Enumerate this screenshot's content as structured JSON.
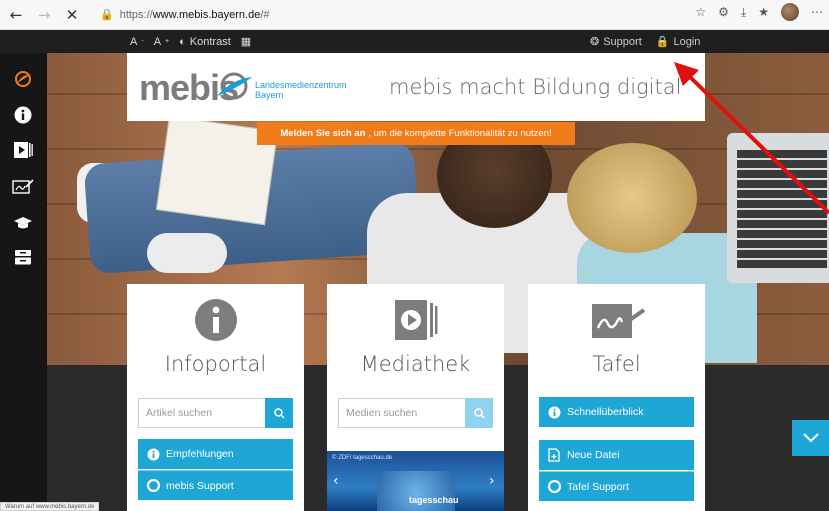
{
  "browser": {
    "url_prefix": "https://",
    "url_host": "www.mebis.bayern.de",
    "url_path": "/#",
    "status_text": "Warum auf www.mebis.bayern.de"
  },
  "toolbar": {
    "font_smaller": "A",
    "font_larger": "A",
    "contrast_label": "Kontrast",
    "support_label": "Support",
    "login_label": "Login"
  },
  "sidebar": {
    "icons": [
      "mebis-logo-icon",
      "info-icon",
      "media-icon",
      "board-icon",
      "graduation-icon",
      "archive-icon"
    ]
  },
  "banner": {
    "logo_word": "mebis",
    "logo_sub_1": "Landesmedienzentrum",
    "logo_sub_2": "Bayern",
    "tagline": "mebis macht Bildung digital"
  },
  "login_hint": {
    "bold": "Melden Sie sich an",
    "rest": ", um die komplette Funktionalität zu nutzen!"
  },
  "cards": {
    "infoportal": {
      "title": "Infoportal",
      "search_placeholder": "Artikel suchen",
      "buttons": [
        "Empfehlungen",
        "mebis Support"
      ]
    },
    "mediathek": {
      "title": "Mediathek",
      "search_placeholder": "Medien suchen",
      "player_title": "© ZDF/ tagesschau.de",
      "player_brand": "tagesschau"
    },
    "tafel": {
      "title": "Tafel",
      "buttons": [
        "Schnellüberblick",
        "Neue Datei",
        "Tafel Support"
      ]
    }
  },
  "colors": {
    "accent": "#1ea6d7",
    "orange": "#f07c1a",
    "annotation_arrow": "#e01010"
  }
}
